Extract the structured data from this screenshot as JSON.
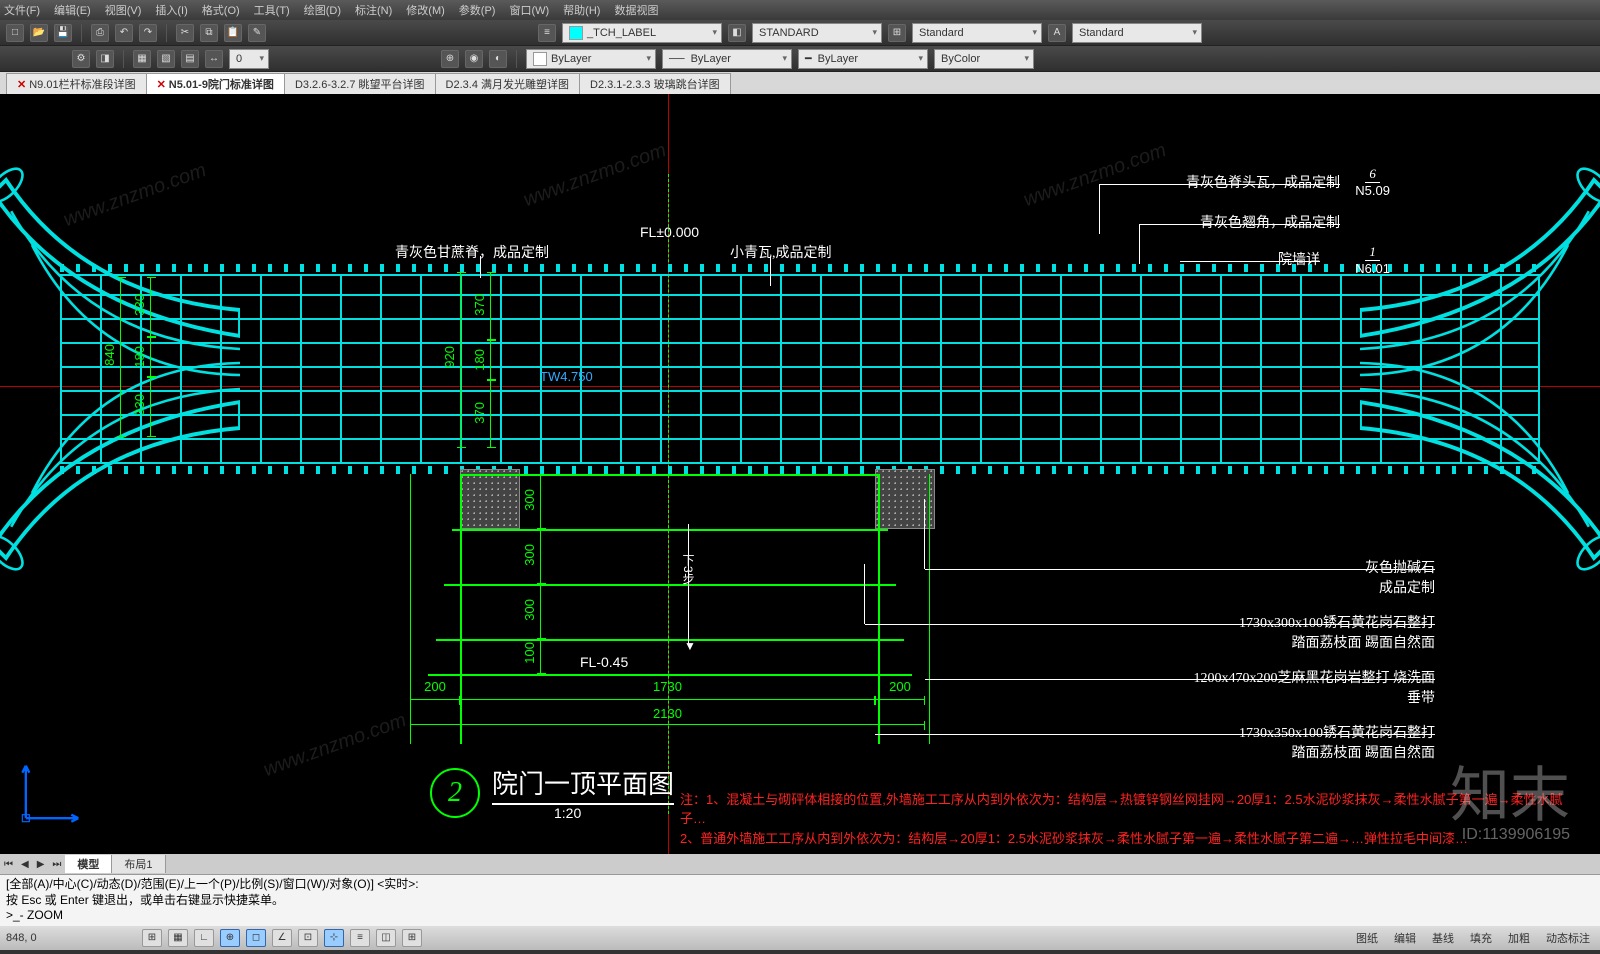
{
  "menu": [
    "文件(F)",
    "编辑(E)",
    "视图(V)",
    "插入(I)",
    "格式(O)",
    "工具(T)",
    "绘图(D)",
    "标注(N)",
    "修改(M)",
    "参数(P)",
    "窗口(W)",
    "帮助(H)",
    "数据视图"
  ],
  "layer_combo": "_TCH_LABEL",
  "dimstyle1": "STANDARD",
  "dimstyle2": "Standard",
  "dimstyle3": "Standard",
  "prop_combos": {
    "layer": "ByLayer",
    "ltype": "ByLayer",
    "lweight": "ByLayer",
    "color": "ByColor"
  },
  "tabs": [
    {
      "label": "N9.01栏杆标准段详图",
      "x": true
    },
    {
      "label": "N5.01-9院门标准详图",
      "x": true,
      "active": true
    },
    {
      "label": "D3.2.6-3.2.7 眺望平台详图"
    },
    {
      "label": "D2.3.4 满月发光雕塑详图"
    },
    {
      "label": "D2.3.1-2.3.3 玻璃跳台详图"
    }
  ],
  "drawing": {
    "fl_top": "FL±0.000",
    "fl_bot": "FL-0.45",
    "tw": "TW4.750",
    "down": "下3步",
    "dims_v_left": [
      "330",
      "180",
      "330",
      "840"
    ],
    "dims_v_mid": [
      "370",
      "180",
      "370",
      "920"
    ],
    "dims_step": [
      "300",
      "300",
      "300",
      "100"
    ],
    "dims_h": [
      "200",
      "1730",
      "200",
      "2130"
    ],
    "annos_top": [
      "青灰色甘蔗脊，成品定制",
      "小青瓦,成品定制",
      "青灰色脊头瓦，成品定制",
      "青灰色翘角，成品定制",
      "院墙详"
    ],
    "annos_right": [
      "灰色抛碱石",
      "成品定制",
      "1730x300x100锈石黄花岗石整打",
      "踏面荔枝面  踢面自然面",
      "1200x470x200芝麻黑花岗岩整打  烧洗面",
      "垂带",
      "1730x350x100锈石黄花岗石整打",
      "踏面荔枝面  踢面自然面"
    ],
    "detail_refs": [
      {
        "n": "6",
        "d": "N5.09"
      },
      {
        "n": "1",
        "d": "N6.01"
      }
    ],
    "title_num": "2",
    "title": "院门一顶平面图",
    "scale": "1:20",
    "notes": [
      "注：1、混凝土与砌砰体相接的位置,外墙施工工序从内到外依次为：结构层→热镀锌钢丝网挂网→20厚1：2.5水泥砂浆抹灰→柔性水腻子第一遍→柔性水腻子…",
      "2、普通外墙施工工序从内到外依次为：结构层→20厚1：2.5水泥砂浆抹灰→柔性水腻子第一遍→柔性水腻子第二遍→…弹性拉毛中间漆…"
    ]
  },
  "layout_tabs": [
    "模型",
    "布局1"
  ],
  "cmd": [
    "[全部(A)/中心(C)/动态(D)/范围(E)/上一个(P)/比例(S)/窗口(W)/对象(O)] <实时>:",
    "按 Esc 或 Enter 键退出，或单击右键显示快捷菜单。",
    ">_- ZOOM"
  ],
  "status": {
    "coord": "848, 0",
    "right": [
      "图纸",
      "编辑",
      "基线",
      "填充",
      "加粗",
      "动态标注"
    ]
  },
  "watermark": "知末",
  "watermark_id": "ID:1139906195",
  "wm_url": "www.znzmo.com"
}
